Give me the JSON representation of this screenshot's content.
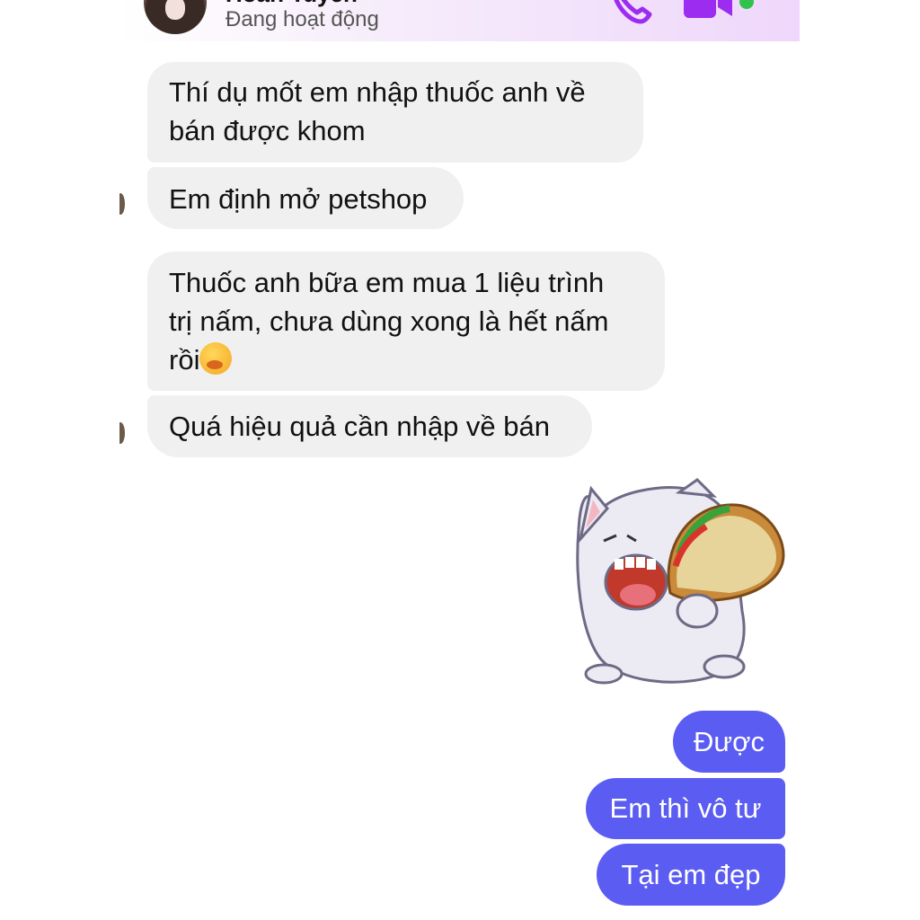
{
  "header": {
    "contact_name": "Hoàn Tuyền",
    "status": "Đang hoạt động",
    "icons": [
      "phone-icon",
      "video-call-icon"
    ],
    "online_color": "#31c24d"
  },
  "messages": {
    "incoming": [
      {
        "line1": "Thí dụ mốt em nhập thuốc anh về",
        "line2": "bán được khom"
      },
      {
        "line1": "Em định mở petshop"
      },
      {
        "line1": "Thuốc anh bữa em mua 1 liệu trình",
        "line2": "trị nấm, chưa dùng xong là hết nấm",
        "line3": "rồi"
      },
      {
        "line1": "Quá hiệu quả cần nhập về bán"
      }
    ],
    "sticker": "white-cat-eating-taco-sticker",
    "outgoing": [
      {
        "text": "Được"
      },
      {
        "text": "Em thì vô tư"
      },
      {
        "text": "Tại em đẹp"
      }
    ]
  },
  "colors": {
    "incoming_bubble": "#f0f0f0",
    "outgoing_bubble": "#5b5cf2",
    "accent": "#8a2be2"
  }
}
